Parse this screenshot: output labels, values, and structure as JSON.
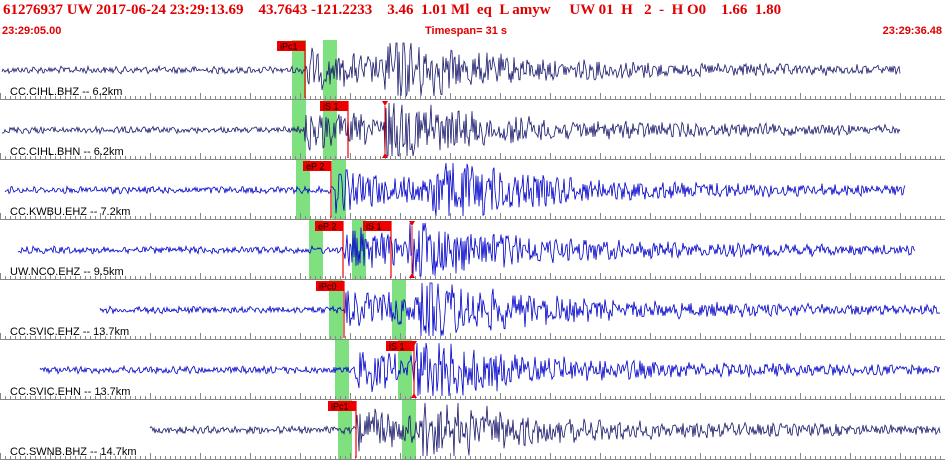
{
  "header": {
    "event_line": "61276937 UW 2017-06-24 23:29:13.69    43.7643 -121.2233    3.46  1.01 Ml  eq  L amyw     UW 01  H   2  -  H O0    1.66  1.80",
    "start_time": "23:29:05.00",
    "timespan": "Timespan=  31 s",
    "end_time": "23:29:36.48"
  },
  "colors": {
    "header_text": "#e00000",
    "pick_red": "#ee0000",
    "window_green": "#7fe07f",
    "trace_dark": "#1a1a6e",
    "trace_blue": "#0000cc",
    "axis_gray": "#888888"
  },
  "traces": [
    {
      "label": "CC.CIHL.BHZ -- 6.2km",
      "color": "dark",
      "picks": [
        {
          "label": "iPc1",
          "mark": false
        }
      ],
      "green_windows": 2
    },
    {
      "label": "CC.CIHL.BHN -- 6.2km",
      "color": "dark",
      "picks": [
        {
          "label": "iS 1",
          "mark": true
        }
      ],
      "green_windows": 2
    },
    {
      "label": "CC.KWBU.EHZ -- 7.2km",
      "color": "blue",
      "picks": [
        {
          "label": "eP 2",
          "mark": false
        }
      ],
      "green_windows": 2
    },
    {
      "label": "UW.NCO.EHZ -- 9.5km",
      "color": "blue",
      "picks": [
        {
          "label": "eP 2",
          "mark": false
        },
        {
          "label": "iS 1",
          "mark": true
        }
      ],
      "green_windows": 3
    },
    {
      "label": "CC.SVIC.EHZ -- 13.7km",
      "color": "blue",
      "picks": [
        {
          "label": "iPc0",
          "mark": false
        }
      ],
      "green_windows": 2
    },
    {
      "label": "CC.SVIC.EHN -- 13.7km",
      "color": "blue",
      "picks": [
        {
          "label": "iS 1",
          "mark": true
        }
      ],
      "green_windows": 2
    },
    {
      "label": "CC.SWNB.BHZ -- 14.7km",
      "color": "dark",
      "picks": [
        {
          "label": "iPc1",
          "mark": false
        }
      ],
      "green_windows": 2
    }
  ]
}
